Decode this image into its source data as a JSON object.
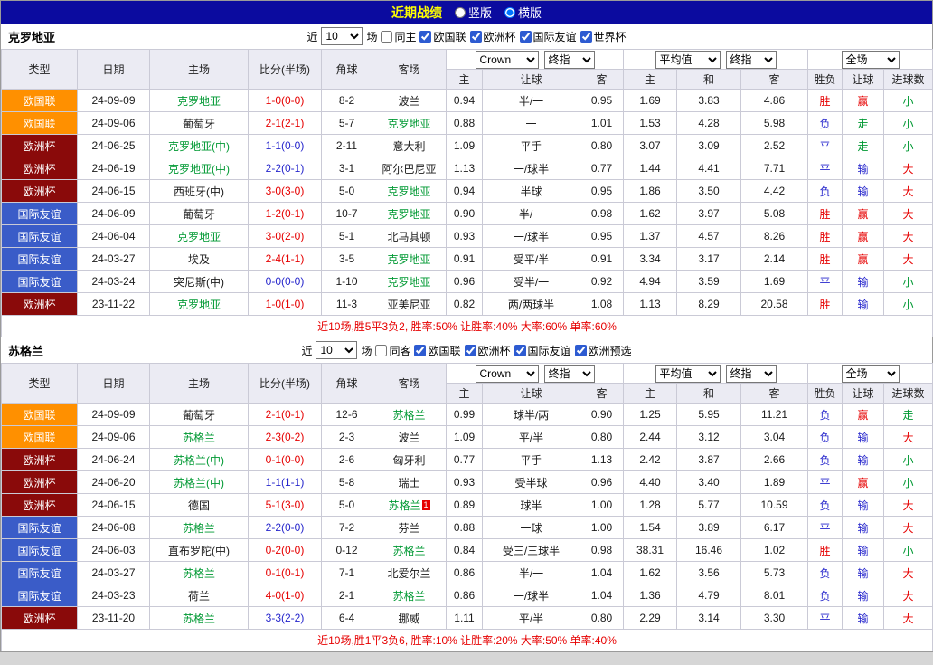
{
  "topbar": {
    "title": "近期战绩",
    "options": [
      {
        "label": "竖版",
        "checked": false
      },
      {
        "label": "横版",
        "checked": true
      }
    ]
  },
  "labels": {
    "near": "近",
    "games": "场"
  },
  "type_colors": {
    "欧国联": "#ff9000",
    "欧洲杯": "#8a0a0a",
    "国际友谊": "#3a5cc8"
  },
  "result_colors": {
    "胜": "red",
    "负": "blue",
    "平": "blue",
    "赢": "red",
    "输": "blue",
    "走": "green",
    "大": "red",
    "小": "green"
  },
  "table_header": {
    "type": "类型",
    "date": "日期",
    "home": "主场",
    "score": "比分(半场)",
    "corner": "角球",
    "away": "客场",
    "bookmaker": "Crown",
    "final_odds": "终指",
    "average": "平均值",
    "final_odds2": "终指",
    "full_match": "全场",
    "sub": [
      "主",
      "让球",
      "客",
      "主",
      "和",
      "客",
      "胜负",
      "让球",
      "进球数"
    ]
  },
  "sections": [
    {
      "team": "克罗地亚",
      "filter": {
        "count": "10",
        "same_label": "同主",
        "same_checked": false,
        "comps": [
          {
            "label": "欧国联",
            "checked": true
          },
          {
            "label": "欧洲杯",
            "checked": true
          },
          {
            "label": "国际友谊",
            "checked": true
          },
          {
            "label": "世界杯",
            "checked": true
          }
        ]
      },
      "rows": [
        {
          "type": "欧国联",
          "date": "24-09-09",
          "home": "克罗地亚",
          "hf": true,
          "score": "1-0(0-0)",
          "draw": false,
          "corner": "8-2",
          "away": "波兰",
          "af": false,
          "o1": "0.94",
          "hd": "半/一",
          "o2": "0.95",
          "a1": "1.69",
          "a2": "3.83",
          "a3": "4.86",
          "wdl": "胜",
          "hc": "赢",
          "ou": "小"
        },
        {
          "type": "欧国联",
          "date": "24-09-06",
          "home": "葡萄牙",
          "hf": false,
          "score": "2-1(2-1)",
          "draw": false,
          "corner": "5-7",
          "away": "克罗地亚",
          "af": true,
          "o1": "0.88",
          "hd": "一",
          "o2": "1.01",
          "a1": "1.53",
          "a2": "4.28",
          "a3": "5.98",
          "wdl": "负",
          "hc": "走",
          "ou": "小"
        },
        {
          "type": "欧洲杯",
          "date": "24-06-25",
          "home": "克罗地亚(中)",
          "hf": true,
          "score": "1-1(0-0)",
          "draw": true,
          "corner": "2-11",
          "away": "意大利",
          "af": false,
          "o1": "1.09",
          "hd": "平手",
          "o2": "0.80",
          "a1": "3.07",
          "a2": "3.09",
          "a3": "2.52",
          "wdl": "平",
          "hc": "走",
          "ou": "小"
        },
        {
          "type": "欧洲杯",
          "date": "24-06-19",
          "home": "克罗地亚(中)",
          "hf": true,
          "score": "2-2(0-1)",
          "draw": true,
          "corner": "3-1",
          "away": "阿尔巴尼亚",
          "af": false,
          "o1": "1.13",
          "hd": "一/球半",
          "o2": "0.77",
          "a1": "1.44",
          "a2": "4.41",
          "a3": "7.71",
          "wdl": "平",
          "hc": "输",
          "ou": "大"
        },
        {
          "type": "欧洲杯",
          "date": "24-06-15",
          "home": "西班牙(中)",
          "hf": false,
          "score": "3-0(3-0)",
          "draw": false,
          "corner": "5-0",
          "away": "克罗地亚",
          "af": true,
          "o1": "0.94",
          "hd": "半球",
          "o2": "0.95",
          "a1": "1.86",
          "a2": "3.50",
          "a3": "4.42",
          "wdl": "负",
          "hc": "输",
          "ou": "大"
        },
        {
          "type": "国际友谊",
          "date": "24-06-09",
          "home": "葡萄牙",
          "hf": false,
          "score": "1-2(0-1)",
          "draw": false,
          "corner": "10-7",
          "away": "克罗地亚",
          "af": true,
          "o1": "0.90",
          "hd": "半/一",
          "o2": "0.98",
          "a1": "1.62",
          "a2": "3.97",
          "a3": "5.08",
          "wdl": "胜",
          "hc": "赢",
          "ou": "大"
        },
        {
          "type": "国际友谊",
          "date": "24-06-04",
          "home": "克罗地亚",
          "hf": true,
          "score": "3-0(2-0)",
          "draw": false,
          "corner": "5-1",
          "away": "北马其顿",
          "af": false,
          "o1": "0.93",
          "hd": "一/球半",
          "o2": "0.95",
          "a1": "1.37",
          "a2": "4.57",
          "a3": "8.26",
          "wdl": "胜",
          "hc": "赢",
          "ou": "大"
        },
        {
          "type": "国际友谊",
          "date": "24-03-27",
          "home": "埃及",
          "hf": false,
          "score": "2-4(1-1)",
          "draw": false,
          "corner": "3-5",
          "away": "克罗地亚",
          "af": true,
          "o1": "0.91",
          "hd": "受平/半",
          "o2": "0.91",
          "a1": "3.34",
          "a2": "3.17",
          "a3": "2.14",
          "wdl": "胜",
          "hc": "赢",
          "ou": "大"
        },
        {
          "type": "国际友谊",
          "date": "24-03-24",
          "home": "突尼斯(中)",
          "hf": false,
          "score": "0-0(0-0)",
          "draw": true,
          "corner": "1-10",
          "away": "克罗地亚",
          "af": true,
          "o1": "0.96",
          "hd": "受半/一",
          "o2": "0.92",
          "a1": "4.94",
          "a2": "3.59",
          "a3": "1.69",
          "wdl": "平",
          "hc": "输",
          "ou": "小"
        },
        {
          "type": "欧洲杯",
          "date": "23-11-22",
          "home": "克罗地亚",
          "hf": true,
          "score": "1-0(1-0)",
          "draw": false,
          "corner": "11-3",
          "away": "亚美尼亚",
          "af": false,
          "o1": "0.82",
          "hd": "两/两球半",
          "o2": "1.08",
          "a1": "1.13",
          "a2": "8.29",
          "a3": "20.58",
          "wdl": "胜",
          "hc": "输",
          "ou": "小"
        }
      ],
      "summary": "近10场,胜5平3负2, 胜率:50% 让胜率:40% 大率:60% 单率:60%"
    },
    {
      "team": "苏格兰",
      "filter": {
        "count": "10",
        "same_label": "同客",
        "same_checked": false,
        "comps": [
          {
            "label": "欧国联",
            "checked": true
          },
          {
            "label": "欧洲杯",
            "checked": true
          },
          {
            "label": "国际友谊",
            "checked": true
          },
          {
            "label": "欧洲预选",
            "checked": true
          }
        ]
      },
      "rows": [
        {
          "type": "欧国联",
          "date": "24-09-09",
          "home": "葡萄牙",
          "hf": false,
          "score": "2-1(0-1)",
          "draw": false,
          "corner": "12-6",
          "away": "苏格兰",
          "af": true,
          "o1": "0.99",
          "hd": "球半/两",
          "o2": "0.90",
          "a1": "1.25",
          "a2": "5.95",
          "a3": "11.21",
          "wdl": "负",
          "hc": "赢",
          "ou": "走"
        },
        {
          "type": "欧国联",
          "date": "24-09-06",
          "home": "苏格兰",
          "hf": true,
          "score": "2-3(0-2)",
          "draw": false,
          "corner": "2-3",
          "away": "波兰",
          "af": false,
          "o1": "1.09",
          "hd": "平/半",
          "o2": "0.80",
          "a1": "2.44",
          "a2": "3.12",
          "a3": "3.04",
          "wdl": "负",
          "hc": "输",
          "ou": "大"
        },
        {
          "type": "欧洲杯",
          "date": "24-06-24",
          "home": "苏格兰(中)",
          "hf": true,
          "score": "0-1(0-0)",
          "draw": false,
          "corner": "2-6",
          "away": "匈牙利",
          "af": false,
          "o1": "0.77",
          "hd": "平手",
          "o2": "1.13",
          "a1": "2.42",
          "a2": "3.87",
          "a3": "2.66",
          "wdl": "负",
          "hc": "输",
          "ou": "小"
        },
        {
          "type": "欧洲杯",
          "date": "24-06-20",
          "home": "苏格兰(中)",
          "hf": true,
          "score": "1-1(1-1)",
          "draw": true,
          "corner": "5-8",
          "away": "瑞士",
          "af": false,
          "o1": "0.93",
          "hd": "受半球",
          "o2": "0.96",
          "a1": "4.40",
          "a2": "3.40",
          "a3": "1.89",
          "wdl": "平",
          "hc": "赢",
          "ou": "小"
        },
        {
          "type": "欧洲杯",
          "date": "24-06-15",
          "home": "德国",
          "hf": false,
          "score": "5-1(3-0)",
          "draw": false,
          "corner": "5-0",
          "away": "苏格兰",
          "af": true,
          "away_card": "1",
          "o1": "0.89",
          "hd": "球半",
          "o2": "1.00",
          "a1": "1.28",
          "a2": "5.77",
          "a3": "10.59",
          "wdl": "负",
          "hc": "输",
          "ou": "大"
        },
        {
          "type": "国际友谊",
          "date": "24-06-08",
          "home": "苏格兰",
          "hf": true,
          "score": "2-2(0-0)",
          "draw": true,
          "corner": "7-2",
          "away": "芬兰",
          "af": false,
          "o1": "0.88",
          "hd": "一球",
          "o2": "1.00",
          "a1": "1.54",
          "a2": "3.89",
          "a3": "6.17",
          "wdl": "平",
          "hc": "输",
          "ou": "大"
        },
        {
          "type": "国际友谊",
          "date": "24-06-03",
          "home": "直布罗陀(中)",
          "hf": false,
          "score": "0-2(0-0)",
          "draw": false,
          "corner": "0-12",
          "away": "苏格兰",
          "af": true,
          "o1": "0.84",
          "hd": "受三/三球半",
          "o2": "0.98",
          "a1": "38.31",
          "a2": "16.46",
          "a3": "1.02",
          "wdl": "胜",
          "hc": "输",
          "ou": "小"
        },
        {
          "type": "国际友谊",
          "date": "24-03-27",
          "home": "苏格兰",
          "hf": true,
          "score": "0-1(0-1)",
          "draw": false,
          "corner": "7-1",
          "away": "北爱尔兰",
          "af": false,
          "o1": "0.86",
          "hd": "半/一",
          "o2": "1.04",
          "a1": "1.62",
          "a2": "3.56",
          "a3": "5.73",
          "wdl": "负",
          "hc": "输",
          "ou": "大"
        },
        {
          "type": "国际友谊",
          "date": "24-03-23",
          "home": "荷兰",
          "hf": false,
          "score": "4-0(1-0)",
          "draw": false,
          "corner": "2-1",
          "away": "苏格兰",
          "af": true,
          "o1": "0.86",
          "hd": "一/球半",
          "o2": "1.04",
          "a1": "1.36",
          "a2": "4.79",
          "a3": "8.01",
          "wdl": "负",
          "hc": "输",
          "ou": "大"
        },
        {
          "type": "欧洲杯",
          "date": "23-11-20",
          "home": "苏格兰",
          "hf": true,
          "score": "3-3(2-2)",
          "draw": true,
          "corner": "6-4",
          "away": "挪威",
          "af": false,
          "o1": "1.11",
          "hd": "平/半",
          "o2": "0.80",
          "a1": "2.29",
          "a2": "3.14",
          "a3": "3.30",
          "wdl": "平",
          "hc": "输",
          "ou": "大"
        }
      ],
      "summary": "近10场,胜1平3负6, 胜率:10% 让胜率:20% 大率:50% 单率:40%"
    }
  ]
}
